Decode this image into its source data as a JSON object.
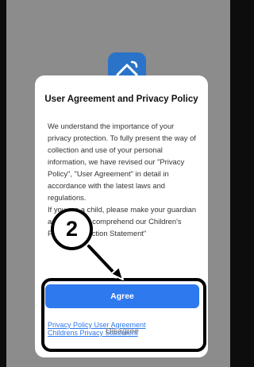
{
  "dialog": {
    "title": "User Agreement and Privacy Policy",
    "body": [
      "We understand the importance of your privacy protection. To fully present the way of collection and use of your personal information, we have revised our \"Privacy Policy\", \"User Agreement\" in detail in accordance with the latest laws and regulations.",
      "If you are a child, please make your guardian agree to fully comprehend our Children's Privacy Protection Statement\""
    ],
    "links": [
      "Privacy Policy User Agreement",
      "Childrens Privacy Statement"
    ],
    "agree_label": "Agree",
    "disagree_label": "Disagree"
  },
  "annotation": {
    "step": "2"
  },
  "icons": {
    "app_logo": "home-wifi-icon"
  },
  "colors": {
    "accent": "#2f79ee",
    "overlay": "#8c8c8c"
  }
}
